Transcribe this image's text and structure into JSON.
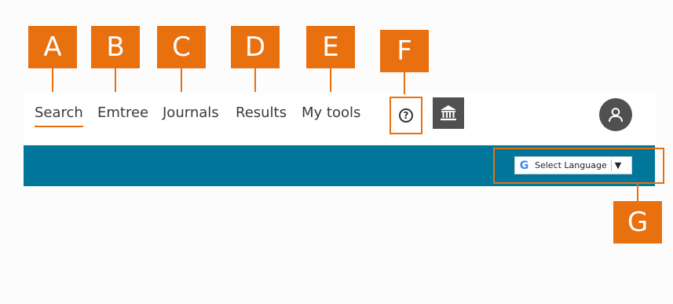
{
  "callouts": {
    "a": "A",
    "b": "B",
    "c": "C",
    "d": "D",
    "e": "E",
    "f": "F",
    "g": "G"
  },
  "nav": {
    "items": [
      "Search",
      "Emtree",
      "Journals",
      "Results",
      "My tools"
    ],
    "active": "Search"
  },
  "toolbar": {
    "help_icon": "question-circle-icon",
    "help_glyph": "?",
    "institution_icon": "institution-icon",
    "account_icon": "user-icon"
  },
  "language": {
    "label": "Select Language",
    "arrow": "▼",
    "icon": "google-icon",
    "icon_glyph": "G"
  },
  "colors": {
    "callout": "#e8700f",
    "banner": "#00779a",
    "dark_button": "#505050"
  }
}
